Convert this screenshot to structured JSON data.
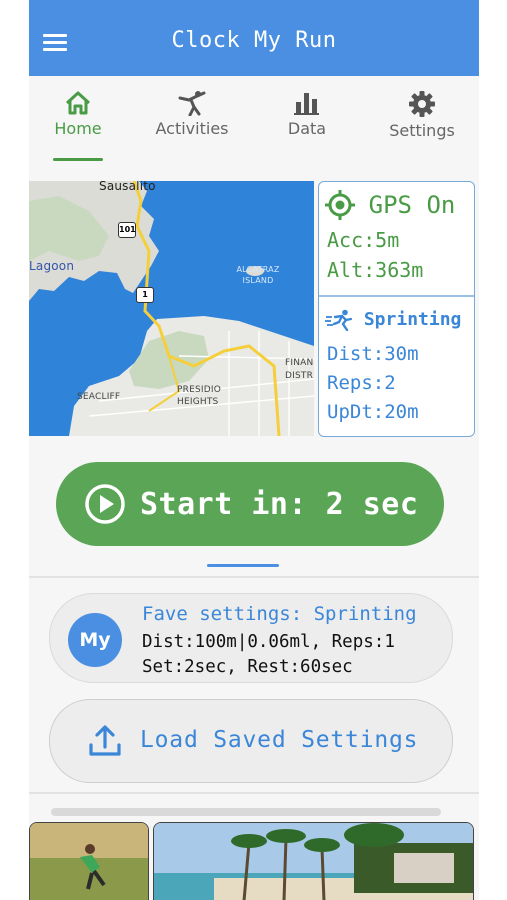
{
  "app": {
    "title": "Clock My Run"
  },
  "tabs": [
    {
      "label": "Home",
      "icon": "home-icon",
      "active": true
    },
    {
      "label": "Activities",
      "icon": "activities-icon",
      "active": false
    },
    {
      "label": "Data",
      "icon": "bar-chart-icon",
      "active": false
    },
    {
      "label": "Settings",
      "icon": "gear-icon",
      "active": false
    }
  ],
  "map": {
    "labels": {
      "sausalito": "Sausalito",
      "lagoon": "Lagoon",
      "alcatraz": "ALCATRAZ ISLAND",
      "presidio": "PRESIDIO HEIGHTS",
      "seacliff": "SEACLIFF",
      "financial": "FINAN DISTR"
    },
    "highways": [
      "101",
      "1"
    ]
  },
  "gps": {
    "status": "GPS On",
    "accuracy": "Acc:5m",
    "altitude": "Alt:363m"
  },
  "activity": {
    "mode": "Sprinting",
    "distance": "Dist:30m",
    "reps": "Reps:2",
    "update": "UpDt:20m"
  },
  "start_button": {
    "label": "Start in: 2 sec"
  },
  "fave": {
    "avatar": "My",
    "title": "Fave settings: Sprinting",
    "line1": "Dist:100m|0.06ml, Reps:1",
    "line2": "Set:2sec, Rest:60sec"
  },
  "load_button": {
    "label": "Load Saved Settings"
  },
  "colors": {
    "appbar": "#4a8fe2",
    "active_tab": "#4a9b45",
    "start_button": "#5aa556",
    "accent_blue": "#3a86d8"
  }
}
